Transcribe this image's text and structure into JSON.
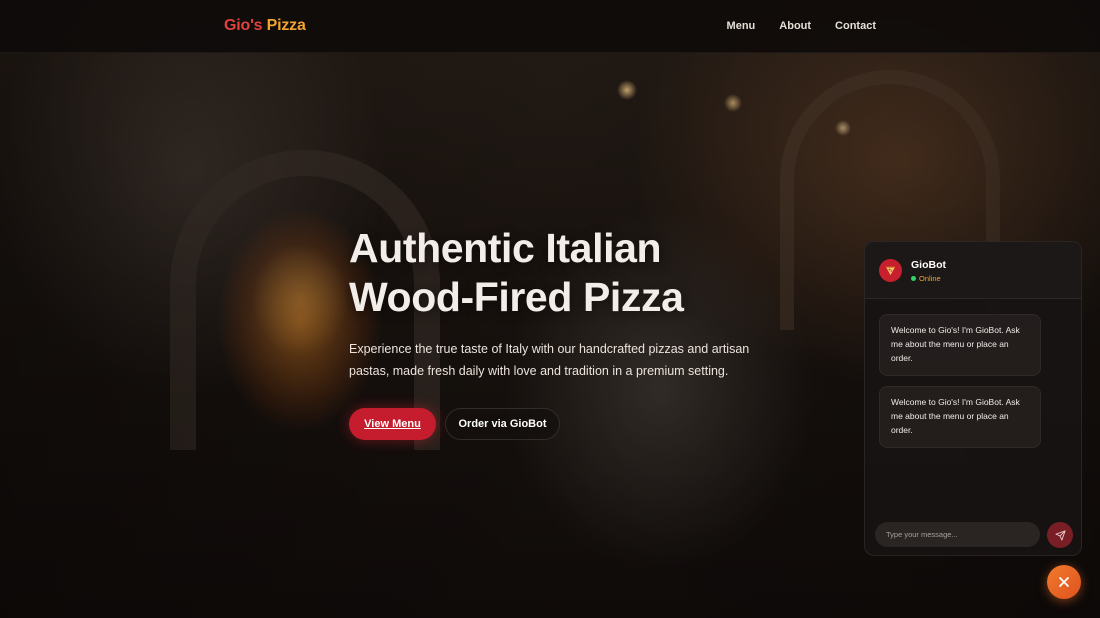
{
  "brand": {
    "part1": "Gio's",
    "part2": " Pizza"
  },
  "nav": {
    "links": [
      "Menu",
      "About",
      "Contact"
    ]
  },
  "hero": {
    "title_line1": "Authentic Italian",
    "title_line2": "Wood-Fired Pizza",
    "subtitle": "Experience the true taste of Italy with our handcrafted pizzas and artisan pastas, made fresh daily with love and tradition in a premium setting.",
    "primary_button": "View Menu",
    "secondary_button": "Order via GioBot"
  },
  "chat": {
    "bot_name": "GioBot",
    "status": "Online",
    "avatar_icon": "pizza-icon",
    "messages": [
      "Welcome to Gio's! I'm GioBot. Ask me about the menu or place an order.",
      "Welcome to Gio's! I'm GioBot. Ask me about the menu or place an order."
    ],
    "input_placeholder": "Type your message...",
    "send_icon": "send-icon",
    "close_icon": "close-icon"
  },
  "colors": {
    "brand_red": "#e2413d",
    "brand_orange": "#f0a32e",
    "primary_button": "#c51d2d",
    "status_online": "#2fd468",
    "fab": "#e8622a"
  }
}
